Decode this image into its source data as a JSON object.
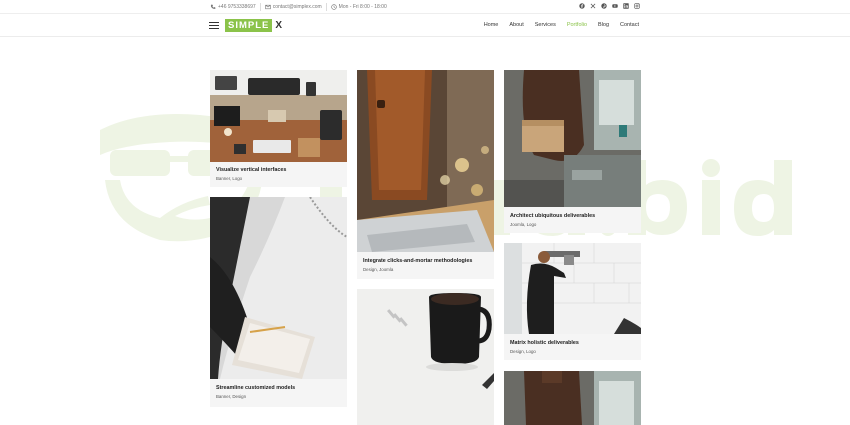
{
  "topbar": {
    "phone": "+46 9753338697",
    "email": "contact@simplex.com",
    "hours": "Mon - Fri 8:00 - 18:00",
    "social_icons": [
      "facebook-icon",
      "x-icon",
      "pinterest-icon",
      "youtube-icon",
      "linkedin-icon",
      "instagram-icon"
    ]
  },
  "header": {
    "logo_box": "SIMPLE",
    "logo_x": "X",
    "nav": [
      "Home",
      "About",
      "Services",
      "Portfolio",
      "Blog",
      "Contact"
    ],
    "active_nav": "Portfolio"
  },
  "colors": {
    "accent": "#8bc34a",
    "card_bg": "#f5f5f5"
  },
  "portfolio": [
    {
      "title": "Visualize vertical interfaces",
      "tags": "Banner, Logo"
    },
    {
      "title": "Streamline customized models",
      "tags": "Banner, Design"
    },
    {
      "title": "Integrate clicks-and-mortar methodologies",
      "tags": "Design, Joomla"
    },
    {
      "title": "Architect ubiquitous deliverables",
      "tags": "Joomla, Logo"
    },
    {
      "title": "Matrix holistic deliverables",
      "tags": "Design, Logo"
    }
  ]
}
